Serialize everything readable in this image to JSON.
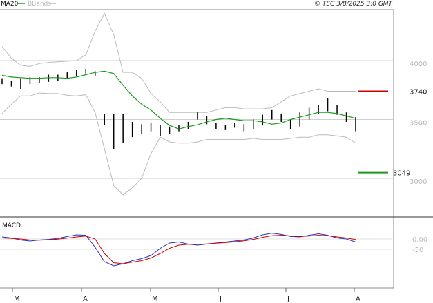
{
  "header": {
    "legend": [
      {
        "label": "MA20",
        "color": "#1a9a1a"
      },
      {
        "label": "BBands",
        "color": "#bbbbbb"
      }
    ],
    "copyright": "© TEC 3/8/2025 3:0 GMT"
  },
  "chart_data": [
    {
      "type": "bar",
      "title": "",
      "y_ticks": [
        "4000",
        "3500",
        "3000"
      ],
      "ylim": [
        2700,
        4200
      ],
      "x_labels": [
        "M",
        "A",
        "M",
        "J",
        "J",
        "A"
      ],
      "levels": [
        {
          "label": "3740",
          "value": 3740,
          "color": "#cc0000"
        },
        {
          "label": "3049",
          "value": 3049,
          "color": "#1a9a1a"
        }
      ],
      "series": [
        {
          "name": "MA20",
          "color": "#1a9a1a",
          "values": [
            3875,
            3860,
            3855,
            3850,
            3850,
            3855,
            3855,
            3850,
            3860,
            3880,
            3900,
            3910,
            3890,
            3790,
            3700,
            3630,
            3580,
            3510,
            3450,
            3420,
            3440,
            3455,
            3480,
            3500,
            3510,
            3500,
            3490,
            3490,
            3480,
            3460,
            3470,
            3500,
            3520,
            3540,
            3560,
            3560,
            3550,
            3530,
            3510
          ]
        },
        {
          "name": "BBands",
          "color": "#bbbbbb",
          "upper": [
            4120,
            4020,
            3960,
            3950,
            3975,
            3985,
            3990,
            3995,
            4000,
            4050,
            4250,
            4400,
            4220,
            3900,
            3900,
            3850,
            3720,
            3650,
            3560,
            3560,
            3560,
            3560,
            3560,
            3580,
            3600,
            3600,
            3590,
            3590,
            3590,
            3600,
            3650,
            3700,
            3720,
            3740,
            3760,
            3740,
            3740,
            3740,
            3740
          ]
        },
        {
          "name": "BBands",
          "color": "#bbbbbb",
          "lower": [
            3550,
            3630,
            3700,
            3700,
            3725,
            3720,
            3720,
            3705,
            3700,
            3710,
            3560,
            3250,
            2940,
            2860,
            2920,
            3000,
            3210,
            3350,
            3310,
            3300,
            3300,
            3310,
            3330,
            3330,
            3330,
            3330,
            3330,
            3340,
            3330,
            3330,
            3330,
            3340,
            3350,
            3350,
            3370,
            3370,
            3360,
            3350,
            3300
          ]
        },
        {
          "name": "Price",
          "color": "#000000",
          "ohlc": [
            [
              3800,
              3850
            ],
            [
              3780,
              3830
            ],
            [
              3760,
              3850
            ],
            [
              3800,
              3860
            ],
            [
              3810,
              3860
            ],
            [
              3820,
              3880
            ],
            [
              3830,
              3880
            ],
            [
              3850,
              3900
            ],
            [
              3870,
              3920
            ],
            [
              3890,
              3930
            ],
            [
              3870,
              3910
            ],
            [
              3450,
              3550
            ],
            [
              3250,
              3550
            ],
            [
              3300,
              3550
            ],
            [
              3350,
              3480
            ],
            [
              3380,
              3460
            ],
            [
              3400,
              3470
            ],
            [
              3360,
              3450
            ],
            [
              3380,
              3440
            ],
            [
              3400,
              3450
            ],
            [
              3420,
              3480
            ],
            [
              3500,
              3560
            ],
            [
              3460,
              3530
            ],
            [
              3420,
              3470
            ],
            [
              3410,
              3450
            ],
            [
              3430,
              3470
            ],
            [
              3400,
              3460
            ],
            [
              3420,
              3500
            ],
            [
              3450,
              3540
            ],
            [
              3500,
              3580
            ],
            [
              3480,
              3550
            ],
            [
              3420,
              3500
            ],
            [
              3440,
              3560
            ],
            [
              3500,
              3600
            ],
            [
              3550,
              3620
            ],
            [
              3570,
              3680
            ],
            [
              3540,
              3620
            ],
            [
              3480,
              3560
            ],
            [
              3400,
              3520
            ]
          ]
        }
      ]
    },
    {
      "type": "line",
      "title": "MACD",
      "y_ticks": [
        "0.00",
        "-50"
      ],
      "ylim": [
        -150,
        40
      ],
      "series": [
        {
          "name": "",
          "color": "#2030c0",
          "values": [
            10,
            5,
            -5,
            -10,
            -5,
            -2,
            3,
            12,
            20,
            18,
            -40,
            -110,
            -130,
            -120,
            -105,
            -95,
            -80,
            -45,
            -20,
            -15,
            -25,
            -30,
            -25,
            -20,
            -15,
            -10,
            -5,
            5,
            20,
            28,
            22,
            12,
            10,
            18,
            25,
            18,
            5,
            0,
            -15
          ]
        },
        {
          "name": "",
          "color": "#cc0000",
          "values": [
            5,
            3,
            0,
            -5,
            -6,
            -4,
            -1,
            4,
            10,
            14,
            0,
            -70,
            -115,
            -120,
            -112,
            -105,
            -92,
            -70,
            -45,
            -30,
            -26,
            -26,
            -24,
            -21,
            -18,
            -14,
            -9,
            -2,
            8,
            16,
            18,
            15,
            12,
            14,
            18,
            16,
            10,
            5,
            -3
          ]
        }
      ]
    }
  ]
}
